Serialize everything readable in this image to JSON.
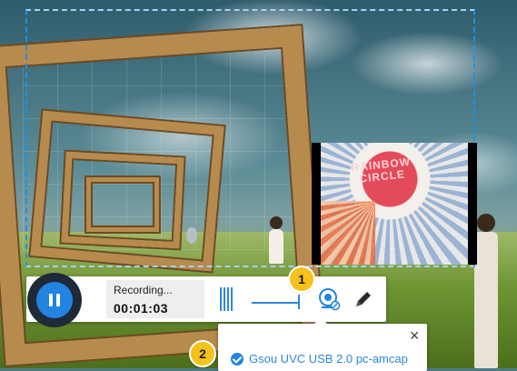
{
  "toolbar": {
    "status_label": "Recording...",
    "elapsed_time": "00:01:03",
    "volume_level": 1.0
  },
  "webcam_preview": {
    "sign_text_line1": "RAINBOW",
    "sign_text_line2": "CIRCLE"
  },
  "callouts": {
    "badge_1": "1",
    "badge_2": "2"
  },
  "camera_popup": {
    "close_glyph": "✕",
    "selected_device": "Gsou UVC USB 2.0 pc-amcap"
  },
  "colors": {
    "accent": "#2184e0",
    "selection_border": "#1e90e8",
    "callout": "#f4c21a",
    "toolbar_bg": "#ffffff"
  },
  "icons": {
    "pause": "pause-icon",
    "webcam": "webcam-icon",
    "pen": "pen-icon",
    "check": "check-icon",
    "close": "close-icon"
  }
}
